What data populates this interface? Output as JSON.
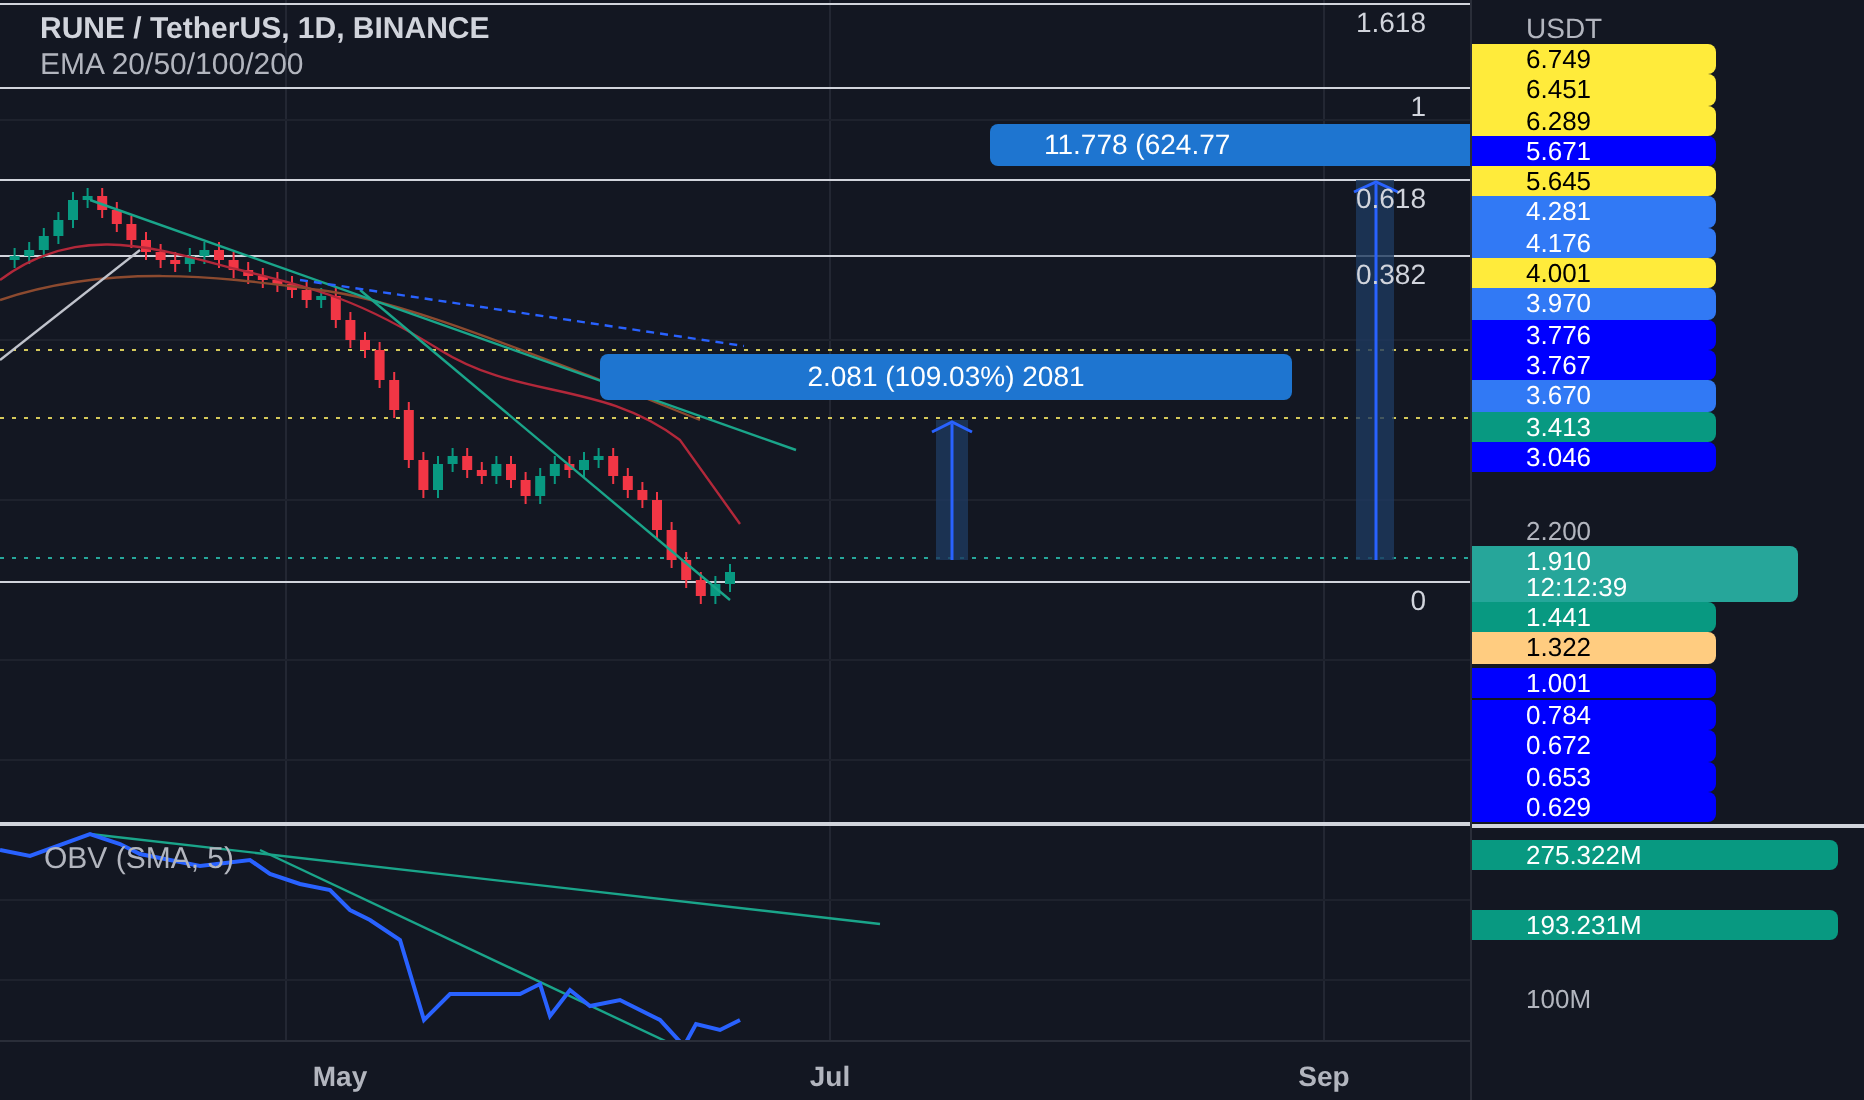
{
  "chart_header": {
    "title": "RUNE / TetherUS, 1D, BINANCE",
    "indicator": "EMA 20/50/100/200"
  },
  "fib_levels": [
    {
      "label": "1.618"
    },
    {
      "label": "1"
    },
    {
      "label": "0.618"
    },
    {
      "label": "0.382"
    },
    {
      "label": "0"
    }
  ],
  "measurements": [
    {
      "label": "2.081 (109.03%) 2081"
    },
    {
      "label": "11.778 (624.77"
    }
  ],
  "price_axis": {
    "currency": "USDT",
    "groups": [
      [
        {
          "kind": "tag",
          "text": "6.749",
          "color": "#ffeb3b"
        },
        {
          "kind": "tag",
          "text": "6.451",
          "color": "#ffeb3b"
        },
        {
          "kind": "tag",
          "text": "6.289",
          "color": "#ffeb3b"
        },
        {
          "kind": "tag",
          "text": "5.671",
          "color": "#0000ff"
        },
        {
          "kind": "tag",
          "text": "5.645",
          "color": "#ffeb3b"
        },
        {
          "kind": "tag",
          "text": "4.281",
          "color": "#3179f5"
        },
        {
          "kind": "tag",
          "text": "4.176",
          "color": "#3179f5"
        },
        {
          "kind": "tag",
          "text": "4.001",
          "color": "#ffeb3b"
        },
        {
          "kind": "tag",
          "text": "3.970",
          "color": "#3179f5"
        },
        {
          "kind": "tag",
          "text": "3.776",
          "color": "#0000ff"
        },
        {
          "kind": "tag",
          "text": "3.767",
          "color": "#0000ff"
        },
        {
          "kind": "tag",
          "text": "3.670",
          "color": "#3179f5"
        },
        {
          "kind": "tag",
          "text": "3.413",
          "color": "#089981"
        },
        {
          "kind": "tag",
          "text": "3.046",
          "color": "#0000ff"
        }
      ],
      [
        {
          "kind": "plain",
          "text": "2.200"
        },
        {
          "kind": "current",
          "text": "1.910",
          "sub": "12:12:39",
          "color": "#26a69a"
        },
        {
          "kind": "tag",
          "text": "1.441",
          "color": "#089981"
        },
        {
          "kind": "tag",
          "text": "1.322",
          "color": "#ffcc80"
        }
      ],
      [
        {
          "kind": "tag",
          "text": "1.001",
          "color": "#0000ff"
        }
      ],
      [
        {
          "kind": "tag",
          "text": "0.784",
          "color": "#0000ff"
        },
        {
          "kind": "tag",
          "text": "0.672",
          "color": "#0000ff"
        },
        {
          "kind": "tag",
          "text": "0.653",
          "color": "#0000ff"
        },
        {
          "kind": "tag",
          "text": "0.629",
          "color": "#0000ff"
        }
      ]
    ]
  },
  "obv_pane": {
    "title": "OBV (SMA, 5)",
    "labels": [
      {
        "kind": "tag",
        "text": "275.322M",
        "color": "#089981"
      },
      {
        "kind": "tag",
        "text": "193.231M",
        "color": "#089981"
      },
      {
        "kind": "plain",
        "text": "100M"
      }
    ]
  },
  "time_axis": [
    "May",
    "Jul",
    "Sep"
  ]
}
